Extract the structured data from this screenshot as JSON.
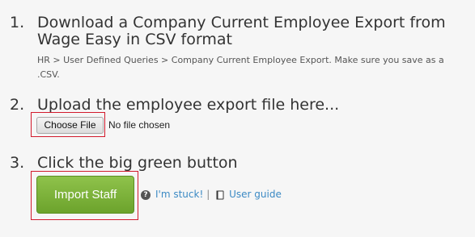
{
  "steps": [
    {
      "number": "1.",
      "title": "Download a Company Current Employee Export from Wage Easy in CSV format",
      "note": "HR > User Defined Queries > Company Current Employee Export. Make sure you save as a .CSV."
    },
    {
      "number": "2.",
      "title": "Upload the employee export file here..."
    },
    {
      "number": "3.",
      "title": "Click the big green button"
    }
  ],
  "file_input": {
    "button_label": "Choose File",
    "status": "No file chosen"
  },
  "import_button": {
    "label": "Import Staff"
  },
  "help": {
    "stuck_icon": "question-circle-icon",
    "stuck_label": "I'm stuck!",
    "separator": "|",
    "guide_icon": "book-icon",
    "guide_label": "User guide"
  },
  "colors": {
    "background": "#f6f6f6",
    "button_green": "#7cb342",
    "highlight_red": "#d21a2c",
    "link_blue": "#3c8ac4"
  }
}
